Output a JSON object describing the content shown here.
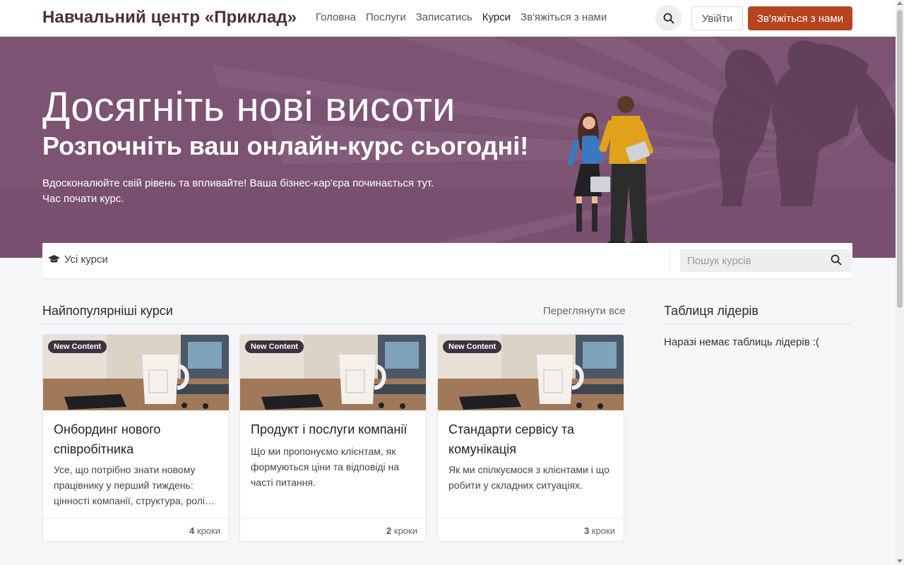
{
  "header": {
    "brand": "Навчальний центр «Приклад»",
    "nav": [
      {
        "label": "Головна",
        "active": false
      },
      {
        "label": "Послуги",
        "active": false
      },
      {
        "label": "Записатись",
        "active": false
      },
      {
        "label": "Курси",
        "active": true
      },
      {
        "label": "Зв'яжіться з нами",
        "active": false
      }
    ],
    "login_label": "Увійти",
    "contact_label": "Зв'яжіться з нами",
    "search_icon": "search-icon"
  },
  "hero": {
    "title": "Досягніть нові висоти",
    "subtitle": "Розпочніть ваш онлайн-курс сьогодні!",
    "text_line1": "Вдосконалюйте свій рівень та впливайте! Ваша бізнес-кар'єра починається тут.",
    "text_line2": "Час почати курс."
  },
  "filter": {
    "all_courses": "Усі курси",
    "search_placeholder": "Пошук курсів"
  },
  "popular": {
    "title": "Найпопулярніші курси",
    "see_all": "Переглянути все"
  },
  "leaderboard": {
    "title": "Таблиця лідерів",
    "empty": "Наразі немає таблиць лідерів :("
  },
  "cards": [
    {
      "badge": "New Content",
      "title": "Онбординг нового співробітника",
      "desc": "Усе, що потрібно знати новому працівнику у перший тиждень: цінності компанії, структура, ролі…",
      "steps_count": "4",
      "steps_label": "кроки"
    },
    {
      "badge": "New Content",
      "title": "Продукт і послуги компанії",
      "desc": "Що ми пропонуємо клієнтам, як формуються ціни та відповіді на часті питання.",
      "steps_count": "2",
      "steps_label": "кроки"
    },
    {
      "badge": "New Content",
      "title": "Стандарти сервісу та комунікація",
      "desc": "Як ми спілкуємося з клієнтами і що робити у складних ситуаціях.",
      "steps_count": "3",
      "steps_label": "кроки"
    }
  ],
  "colors": {
    "brand": "#4b2d42",
    "accent": "#b5441f",
    "hero_bg": "#7c5373"
  }
}
